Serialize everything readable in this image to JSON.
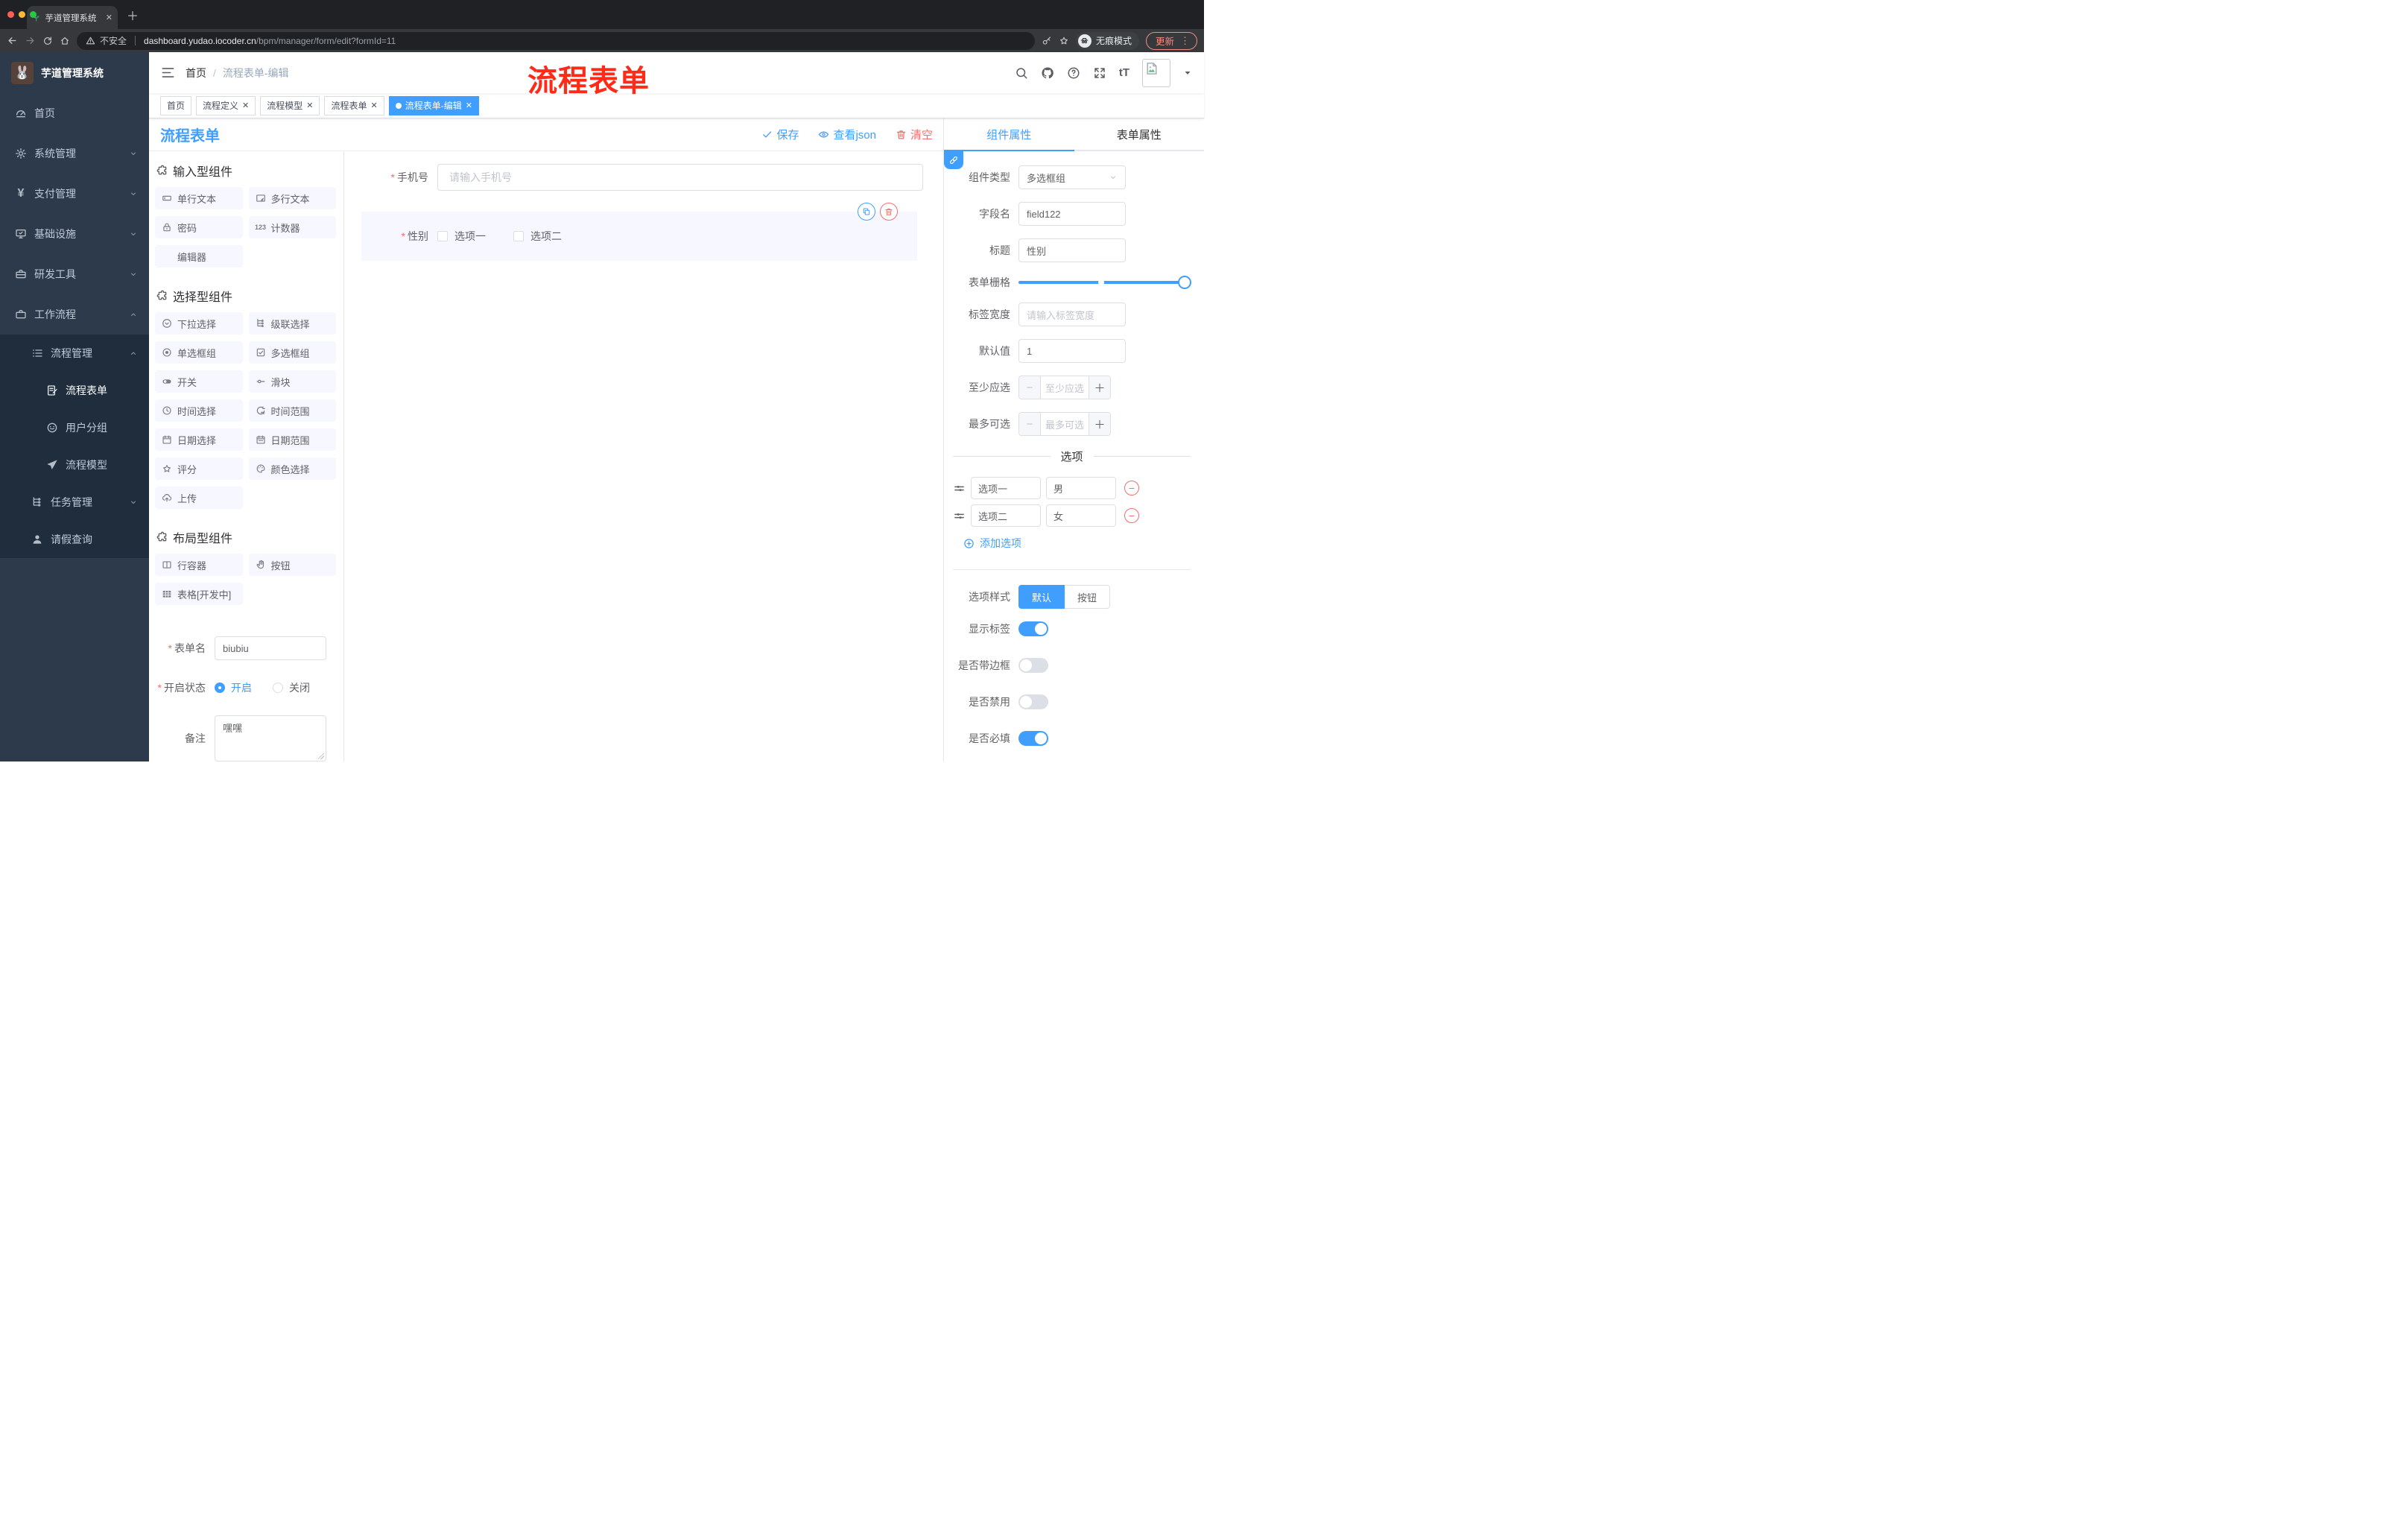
{
  "colors": {
    "accent": "#409eff",
    "danger": "#f56c6c",
    "annotation_red": "#fd2b18",
    "sidebar_bg": "#2d3a4b",
    "submenu_bg": "#1f2d3d"
  },
  "browser": {
    "tab_title": "芋道管理系统",
    "security_label": "不安全",
    "url_host": "dashboard.yudao.iocoder.cn",
    "url_path": "/bpm/manager/form/edit?formId=11",
    "incognito_label": "无痕模式",
    "update_label": "更新"
  },
  "sidebar": {
    "brand": "芋道管理系统",
    "items": [
      {
        "label": "首页",
        "icon": "dash",
        "level": 1
      },
      {
        "label": "系统管理",
        "icon": "gear",
        "level": 1,
        "chevron": "down"
      },
      {
        "label": "支付管理",
        "icon": "yen",
        "level": 1,
        "chevron": "down"
      },
      {
        "label": "基础设施",
        "icon": "monitor",
        "level": 1,
        "chevron": "down"
      },
      {
        "label": "研发工具",
        "icon": "toolbox",
        "level": 1,
        "chevron": "down"
      },
      {
        "label": "工作流程",
        "icon": "briefcase",
        "level": 1,
        "chevron": "up"
      },
      {
        "label": "流程管理",
        "icon": "listtree",
        "level": 2,
        "chevron": "up",
        "dark": true
      },
      {
        "label": "流程表单",
        "icon": "docedit",
        "level": 3,
        "dark": true,
        "active": true
      },
      {
        "label": "用户分组",
        "icon": "face",
        "level": 3,
        "dark": true
      },
      {
        "label": "流程模型",
        "icon": "plane",
        "level": 3,
        "dark": true
      },
      {
        "label": "任务管理",
        "icon": "orgtree",
        "level": 2,
        "chevron": "down",
        "dark": true
      },
      {
        "label": "请假查询",
        "icon": "person",
        "level": 2,
        "dark": true
      }
    ]
  },
  "navbar": {
    "breadcrumb": {
      "home": "首页",
      "sep": "/",
      "current": "流程表单-编辑"
    },
    "annotation": "流程表单"
  },
  "tags": [
    {
      "label": "首页",
      "closable": false,
      "active": false
    },
    {
      "label": "流程定义",
      "closable": true,
      "active": false
    },
    {
      "label": "流程模型",
      "closable": true,
      "active": false
    },
    {
      "label": "流程表单",
      "closable": true,
      "active": false
    },
    {
      "label": "流程表单-编辑",
      "closable": true,
      "active": true
    }
  ],
  "toolbar": {
    "title": "流程表单",
    "save": "保存",
    "view_json": "查看json",
    "clear": "清空"
  },
  "palette": {
    "sections": [
      {
        "title": "输入型组件",
        "items": [
          {
            "label": "单行文本",
            "icon": "inputbox"
          },
          {
            "label": "多行文本",
            "icon": "textareabox"
          },
          {
            "label": "密码",
            "icon": "lock"
          },
          {
            "label": "计数器",
            "icon": "num123"
          },
          {
            "label": "编辑器",
            "icon": ""
          }
        ]
      },
      {
        "title": "选择型组件",
        "items": [
          {
            "label": "下拉选择",
            "icon": "selectchev"
          },
          {
            "label": "级联选择",
            "icon": "orgtree"
          },
          {
            "label": "单选框组",
            "icon": "radiodot"
          },
          {
            "label": "多选框组",
            "icon": "checkboxic"
          },
          {
            "label": "开关",
            "icon": "switchic"
          },
          {
            "label": "滑块",
            "icon": "slideric"
          },
          {
            "label": "时间选择",
            "icon": "clock"
          },
          {
            "label": "时间范围",
            "icon": "timerange"
          },
          {
            "label": "日期选择",
            "icon": "calendar"
          },
          {
            "label": "日期范围",
            "icon": "daterange"
          },
          {
            "label": "评分",
            "icon": "staro"
          },
          {
            "label": "颜色选择",
            "icon": "paletteic"
          },
          {
            "label": "上传",
            "icon": "upload"
          }
        ]
      },
      {
        "title": "布局型组件",
        "items": [
          {
            "label": "行容器",
            "icon": "columns"
          },
          {
            "label": "按钮",
            "icon": "hand"
          },
          {
            "label": "表格[开发中]",
            "icon": "tablegrid"
          }
        ]
      }
    ]
  },
  "canvas": {
    "phone": {
      "label": "手机号",
      "required": true,
      "placeholder": "请输入手机号"
    },
    "gender": {
      "label": "性别",
      "required": true,
      "options": [
        "选项一",
        "选项二"
      ],
      "selected": true
    }
  },
  "left_form": {
    "name": {
      "label": "表单名",
      "required": true,
      "value": "biubiu"
    },
    "status": {
      "label": "开启状态",
      "required": true,
      "on": "开启",
      "off": "关闭",
      "checked": "开启"
    },
    "remark": {
      "label": "备注",
      "value": "嘿嘿"
    }
  },
  "panel": {
    "tab_component": "组件属性",
    "tab_form": "表单属性",
    "rows": [
      {
        "type": "select",
        "label": "组件类型",
        "value": "多选框组"
      },
      {
        "type": "input",
        "label": "字段名",
        "value": "field122"
      },
      {
        "type": "input",
        "label": "标题",
        "value": "性别"
      },
      {
        "type": "slider",
        "label": "表单栅格",
        "value": 24,
        "mark_percent": 48
      },
      {
        "type": "input",
        "label": "标签宽度",
        "placeholder": "请输入标签宽度"
      },
      {
        "type": "input",
        "label": "默认值",
        "value": "1"
      },
      {
        "type": "stepper",
        "label": "至少应选",
        "placeholder": "至少应选"
      },
      {
        "type": "stepper",
        "label": "最多可选",
        "placeholder": "最多可选"
      },
      {
        "type": "divider-text",
        "text": "选项"
      },
      {
        "type": "option",
        "fields": [
          "选项一",
          "男"
        ]
      },
      {
        "type": "option",
        "fields": [
          "选项二",
          "女"
        ]
      },
      {
        "type": "add-link",
        "label": "添加选项"
      },
      {
        "type": "divider"
      },
      {
        "type": "segmented",
        "label": "选项样式",
        "options": [
          "默认",
          "按钮"
        ],
        "active": 0
      },
      {
        "type": "switch",
        "label": "显示标签",
        "on": true
      },
      {
        "type": "switch",
        "label": "是否带边框",
        "on": false
      },
      {
        "type": "switch",
        "label": "是否禁用",
        "on": false
      },
      {
        "type": "switch",
        "label": "是否必填",
        "on": true
      }
    ]
  }
}
